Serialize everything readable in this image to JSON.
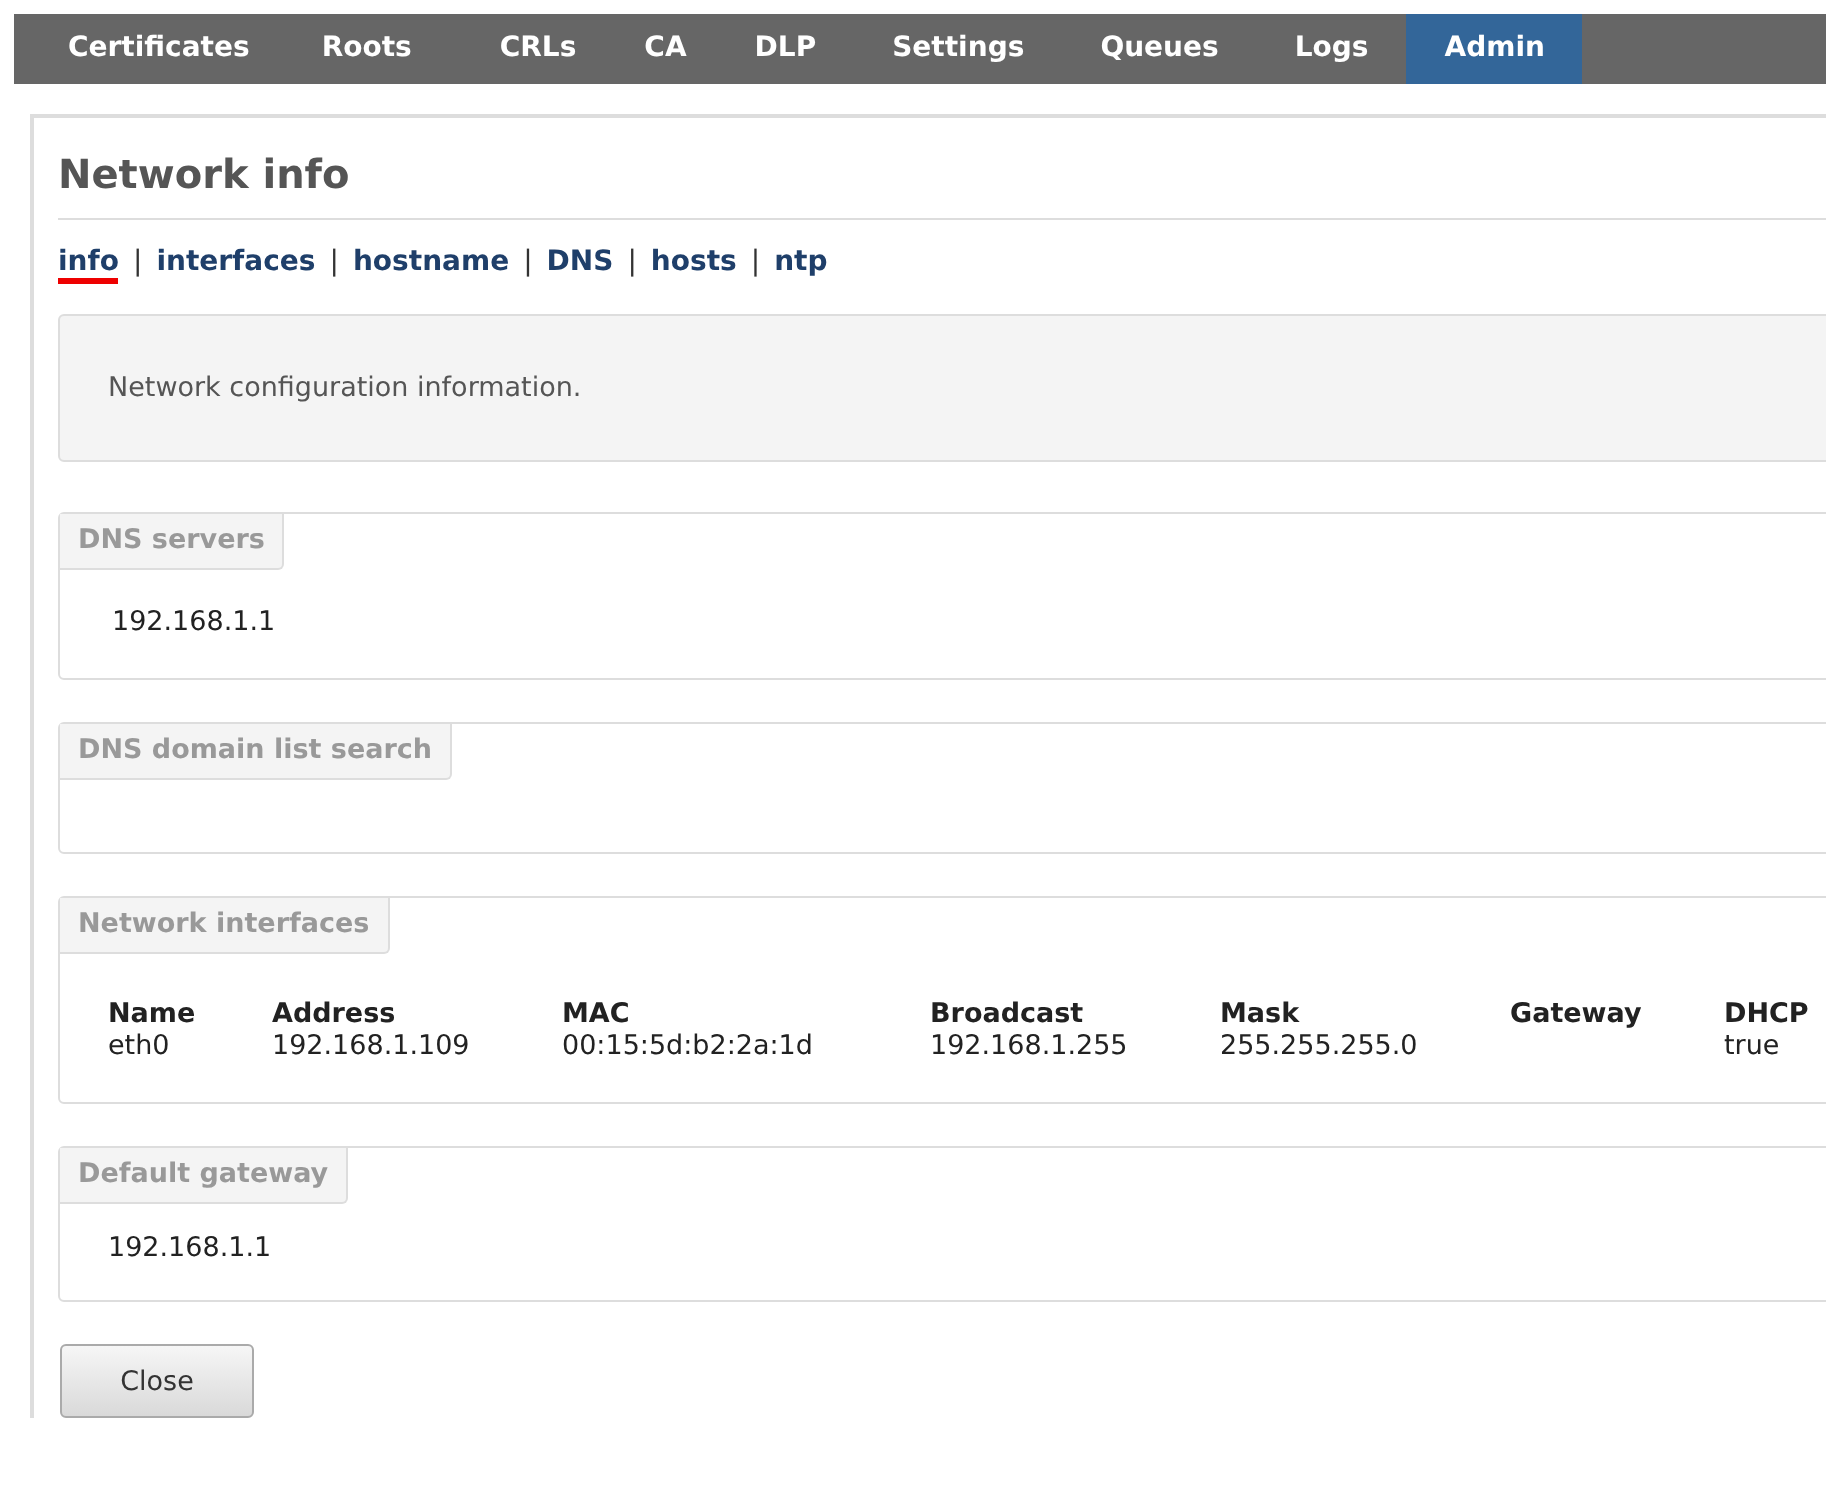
{
  "nav": [
    {
      "label": "Certificates",
      "selected": false
    },
    {
      "label": "Roots",
      "selected": false
    },
    {
      "label": "CRLs",
      "selected": false
    },
    {
      "label": "CA",
      "selected": false
    },
    {
      "label": "DLP",
      "selected": false
    },
    {
      "label": "Settings",
      "selected": false
    },
    {
      "label": "Queues",
      "selected": false
    },
    {
      "label": "Logs",
      "selected": false
    },
    {
      "label": "Admin",
      "selected": true
    }
  ],
  "title": "Network info",
  "links": [
    {
      "label": "info",
      "selected": true
    },
    {
      "label": "interfaces",
      "selected": false
    },
    {
      "label": "hostname",
      "selected": false
    },
    {
      "label": "DNS",
      "selected": false
    },
    {
      "label": "hosts",
      "selected": false
    },
    {
      "label": "ntp",
      "selected": false
    }
  ],
  "separator": "|",
  "info": "Network configuration information.",
  "sections": [
    {
      "kind": "value",
      "legend": "DNS servers",
      "value": "192.168.1.1"
    },
    {
      "kind": "value",
      "legend": "DNS domain list search"
    },
    {
      "kind": "table",
      "legend": "Network interfaces",
      "columns": [
        "Name",
        "Address",
        "MAC",
        "Broadcast",
        "Mask",
        "Gateway",
        "DHCP"
      ],
      "rows": [
        [
          "eth0",
          "192.168.1.109",
          "00:15:5d:b2:2a:1d",
          "192.168.1.255",
          "255.255.255.0",
          "",
          "true"
        ]
      ]
    },
    {
      "kind": "value",
      "legend": "Default gateway",
      "value": "192.168.1.1"
    }
  ],
  "close_button": "Close"
}
